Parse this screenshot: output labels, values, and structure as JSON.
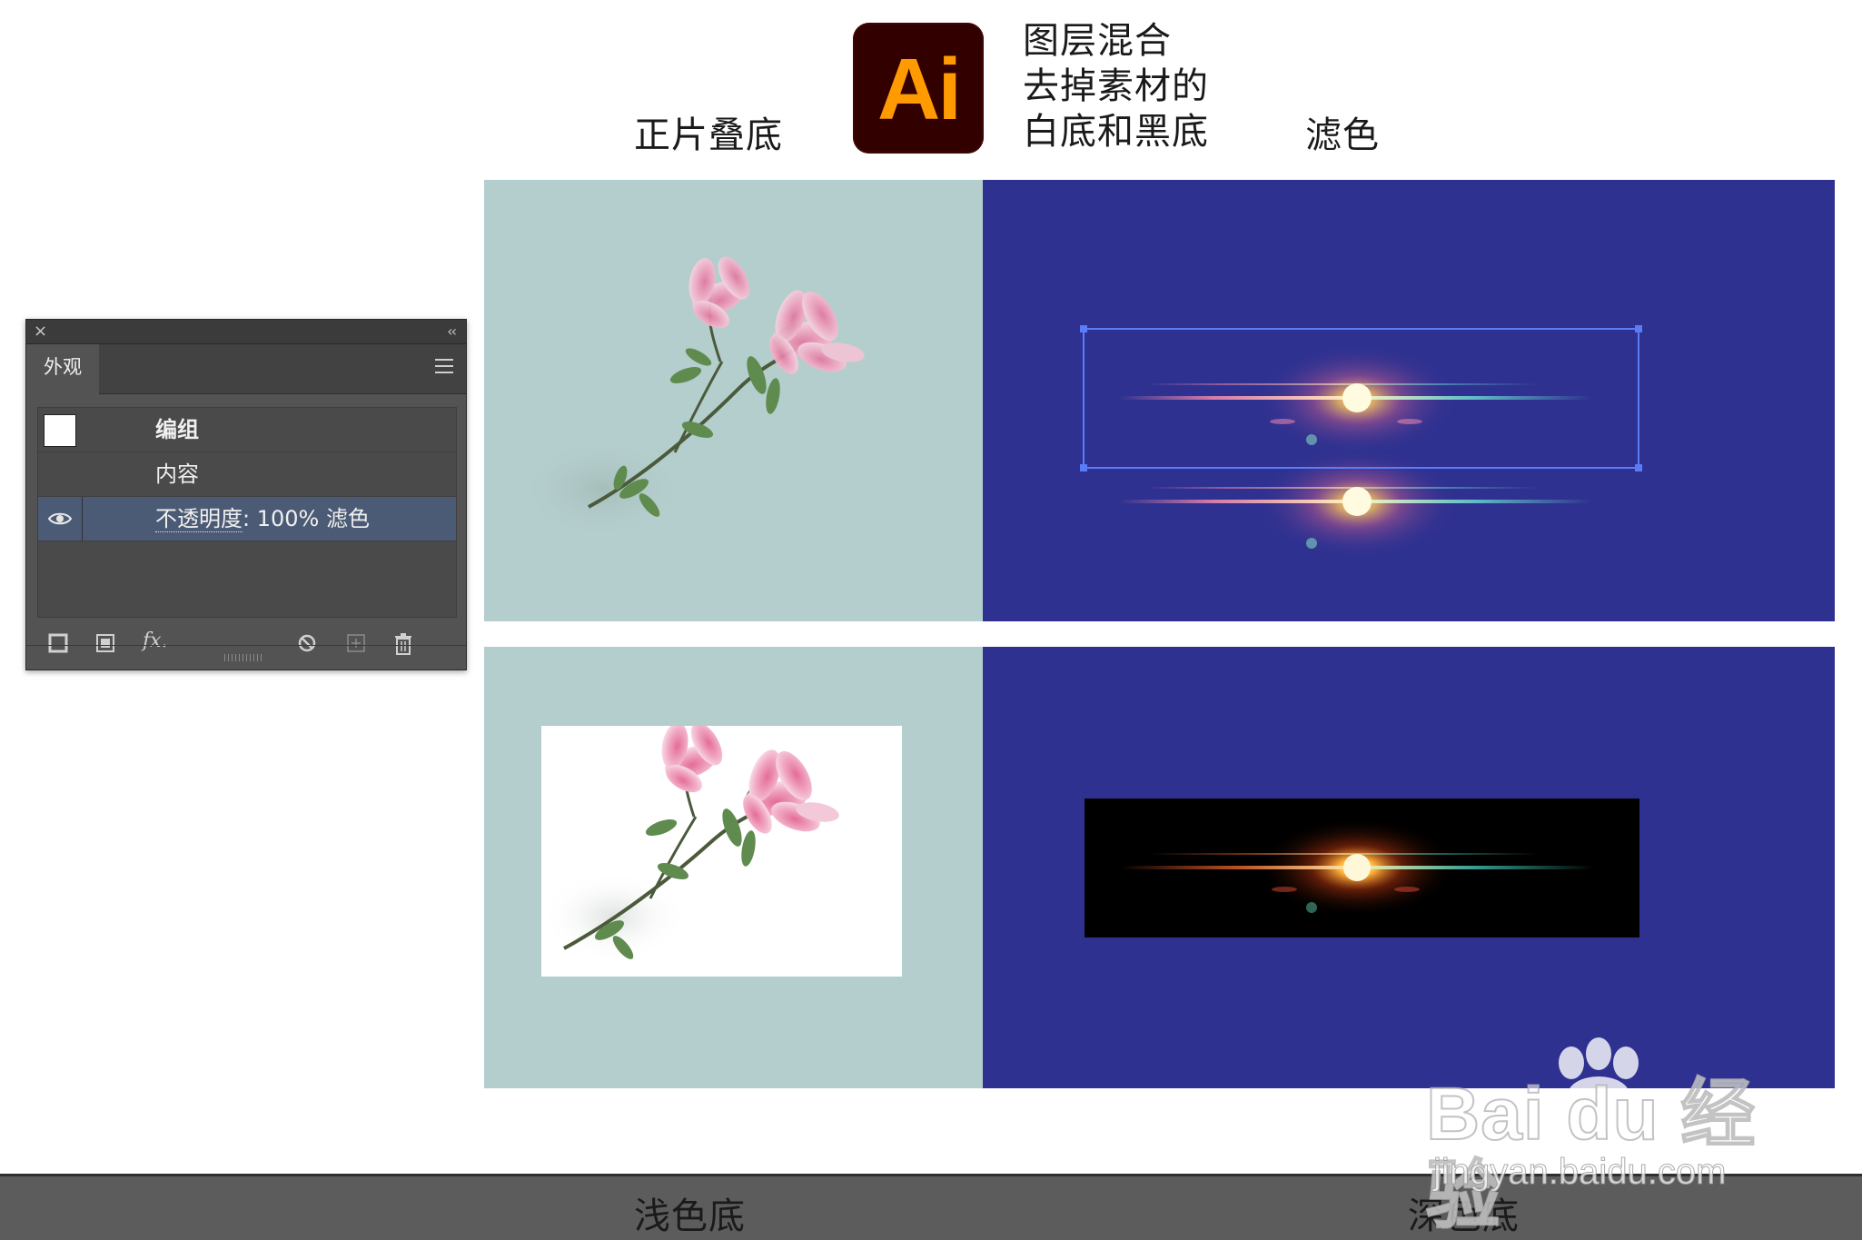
{
  "headings": {
    "multiply": "正片叠底",
    "description": [
      "图层混合",
      "去掉素材的",
      "白底和黑底"
    ],
    "screen": "滤色",
    "light_bg": "浅色底",
    "dark_bg": "深色底"
  },
  "logo": {
    "text": "Ai",
    "bg_color": "#330000",
    "text_color": "#ff9a00"
  },
  "colors": {
    "light_panel": "#b4cdcd",
    "dark_panel": "#2f3190",
    "selection": "#5b7cf7"
  },
  "appearance_panel": {
    "close_glyph": "×",
    "collapse_glyph": "‹‹",
    "tab_label": "外观",
    "rows": [
      {
        "label": "编组"
      },
      {
        "label": "内容"
      },
      {
        "label_link": "不透明度",
        "label_rest": ": 100% 滤色"
      }
    ],
    "footer_icons": [
      "new-stroke-icon",
      "new-fill-icon",
      "fx-icon",
      "clear-appearance-icon",
      "duplicate-item-icon",
      "delete-icon"
    ],
    "fx_label": "fx."
  },
  "watermark": {
    "main": "Bai du 经验",
    "sub": "jingyan.baidu.com"
  }
}
